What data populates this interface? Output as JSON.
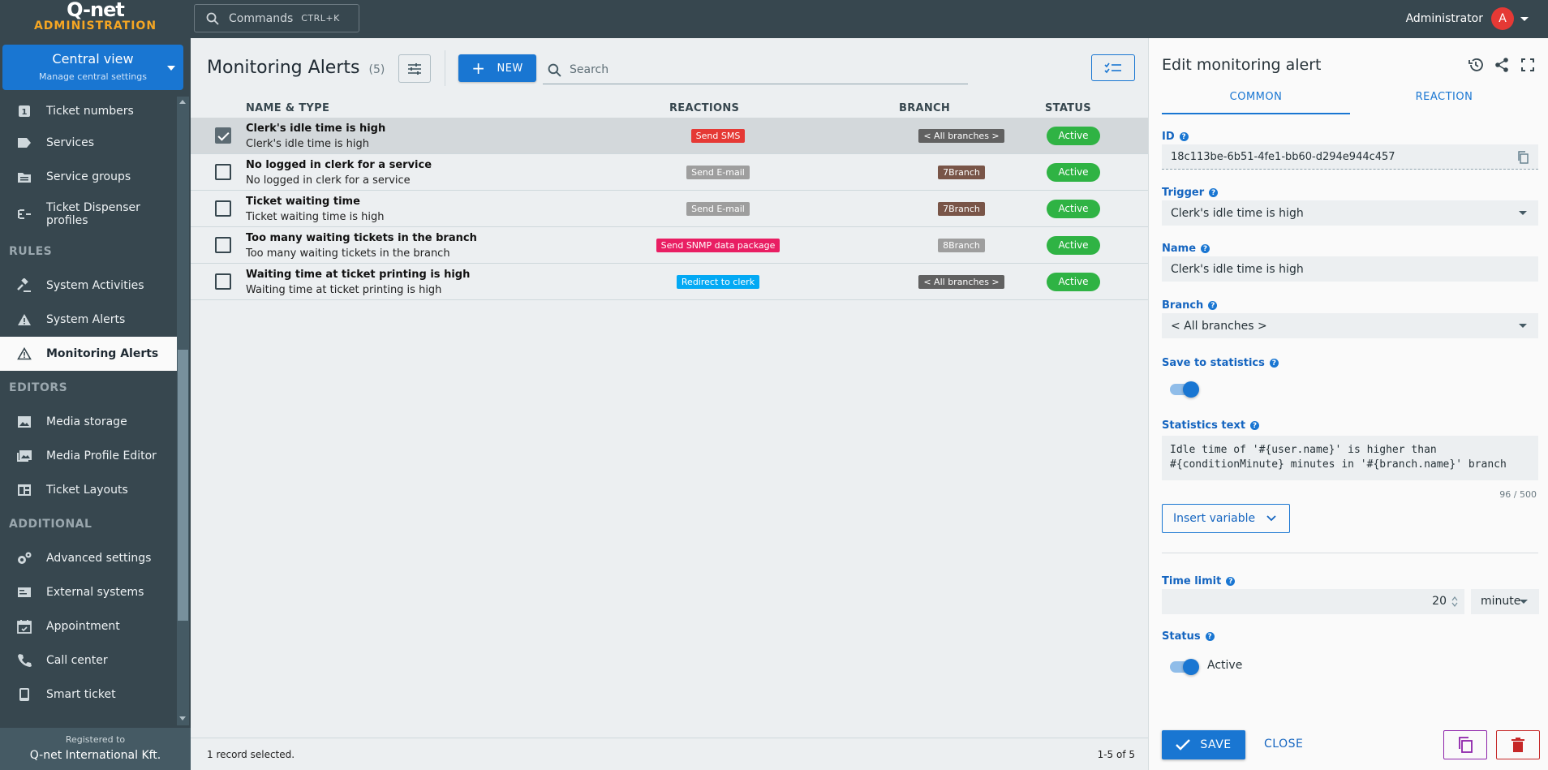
{
  "brand": {
    "logo": "Q-net",
    "subtitle": "ADMINISTRATION"
  },
  "topbar": {
    "command_placeholder": "Commands",
    "command_shortcut": "CTRL+K",
    "user_name": "Administrator",
    "avatar_letter": "A"
  },
  "sidebar": {
    "central_title": "Central view",
    "central_subtitle": "Manage central settings",
    "items": [
      {
        "label": "Ticket numbers",
        "icon": "number-1-icon"
      },
      {
        "label": "Services",
        "icon": "label-icon"
      },
      {
        "label": "Service groups",
        "icon": "folder-icon"
      },
      {
        "label": "Ticket Dispenser profiles",
        "icon": "dispenser-icon"
      }
    ],
    "section_rules": "RULES",
    "rules_items": [
      {
        "label": "System Activities",
        "icon": "gavel-icon"
      },
      {
        "label": "System Alerts",
        "icon": "warning-icon"
      },
      {
        "label": "Monitoring Alerts",
        "icon": "warning-outline-icon"
      }
    ],
    "section_editors": "EDITORS",
    "editors_items": [
      {
        "label": "Media storage",
        "icon": "image-icon"
      },
      {
        "label": "Media Profile Editor",
        "icon": "images-icon"
      },
      {
        "label": "Ticket Layouts",
        "icon": "layout-icon"
      }
    ],
    "section_additional": "ADDITIONAL",
    "additional_items": [
      {
        "label": "Advanced settings",
        "icon": "gears-icon"
      },
      {
        "label": "External systems",
        "icon": "external-icon"
      },
      {
        "label": "Appointment",
        "icon": "calendar-icon"
      },
      {
        "label": "Call center",
        "icon": "phone-icon"
      },
      {
        "label": "Smart ticket",
        "icon": "smartphone-icon"
      }
    ],
    "registered_label": "Registered to",
    "registered_company": "Q-net International Kft."
  },
  "main": {
    "title": "Monitoring Alerts",
    "count": "(5)",
    "new_label": "NEW",
    "search_placeholder": "Search",
    "columns": {
      "name": "NAME & TYPE",
      "reactions": "REACTIONS",
      "branch": "BRANCH",
      "status": "STATUS"
    },
    "rows": [
      {
        "title": "Clerk's idle time is high",
        "subtitle": "Clerk's idle time is high",
        "reaction": "Send SMS",
        "reaction_color": "#e53935",
        "branch": "< All branches >",
        "branch_color": "#616161",
        "status": "Active",
        "checked": true
      },
      {
        "title": "No logged in clerk for a service",
        "subtitle": "No logged in clerk for a service",
        "reaction": "Send E-mail",
        "reaction_color": "#9e9e9e",
        "branch": "7Branch",
        "branch_color": "#795548",
        "status": "Active",
        "checked": false
      },
      {
        "title": "Ticket waiting time",
        "subtitle": "Ticket waiting time is high",
        "reaction": "Send E-mail",
        "reaction_color": "#9e9e9e",
        "branch": "7Branch",
        "branch_color": "#795548",
        "status": "Active",
        "checked": false
      },
      {
        "title": "Too many waiting tickets in the branch",
        "subtitle": "Too many waiting tickets in the branch",
        "reaction": "Send SNMP data package",
        "reaction_color": "#e91e63",
        "branch": "8Branch",
        "branch_color": "#9e9e9e",
        "status": "Active",
        "checked": false
      },
      {
        "title": "Waiting time at ticket printing is high",
        "subtitle": "Waiting time at ticket printing is high",
        "reaction": "Redirect to clerk",
        "reaction_color": "#03a9f4",
        "branch": "< All branches >",
        "branch_color": "#616161",
        "status": "Active",
        "checked": false
      }
    ],
    "footer_selected": "1 record selected.",
    "footer_pagination": "1-5 of 5"
  },
  "panel": {
    "title": "Edit monitoring alert",
    "tabs": [
      "COMMON",
      "REACTION"
    ],
    "id_label": "ID",
    "id_value": "18c113be-6b51-4fe1-bb60-d294e944c457",
    "trigger_label": "Trigger",
    "trigger_value": "Clerk's idle time is high",
    "name_label": "Name",
    "name_value": "Clerk's idle time is high",
    "branch_label": "Branch",
    "branch_value": "< All branches >",
    "save_stats_label": "Save to statistics",
    "save_stats_on": true,
    "stat_text_label": "Statistics text",
    "stat_text_value": "Idle time of '#{user.name}' is higher than\n#{conditionMinute} minutes in '#{branch.name}' branch",
    "stat_counter": "96 / 500",
    "insert_variable_label": "Insert variable",
    "time_limit_label": "Time limit",
    "time_limit_value": "20",
    "time_unit": "minute",
    "status_label": "Status",
    "status_value": "Active",
    "save_label": "SAVE",
    "close_label": "CLOSE"
  },
  "colors": {
    "accent": "#1976d2",
    "sidebar": "#37474f",
    "active_status": "#2fb344",
    "brand_orange": "#f5a623"
  }
}
